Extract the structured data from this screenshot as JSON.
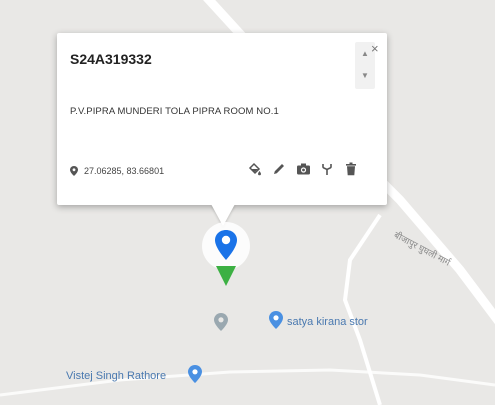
{
  "info_window": {
    "title": "S24A319332",
    "address": "P.V.PIPRA MUNDERI TOLA PIPRA ROOM NO.1",
    "coordinates": "27.06285, 83.66801",
    "close_symbol": "×",
    "scroll_up_symbol": "▲",
    "scroll_down_symbol": "▼",
    "actions": [
      {
        "icon": "paint-bucket-icon"
      },
      {
        "icon": "pencil-icon"
      },
      {
        "icon": "camera-icon"
      },
      {
        "icon": "fork-icon"
      },
      {
        "icon": "trash-icon"
      }
    ]
  },
  "map": {
    "road_label": "बीजापुर घुघली मार्ग",
    "places": [
      {
        "name": "satya kirana stor",
        "icon": "place-pin-icon"
      },
      {
        "name": "Vistej Singh Rathore",
        "icon": "place-pin-icon"
      }
    ],
    "colors": {
      "background": "#e9e8e6",
      "road": "#ffffff",
      "marker_blue": "#1a73e8",
      "marker_green": "#3cb043",
      "poi_blue": "#4a90e2",
      "poi_gray": "#9aa8b0"
    }
  }
}
